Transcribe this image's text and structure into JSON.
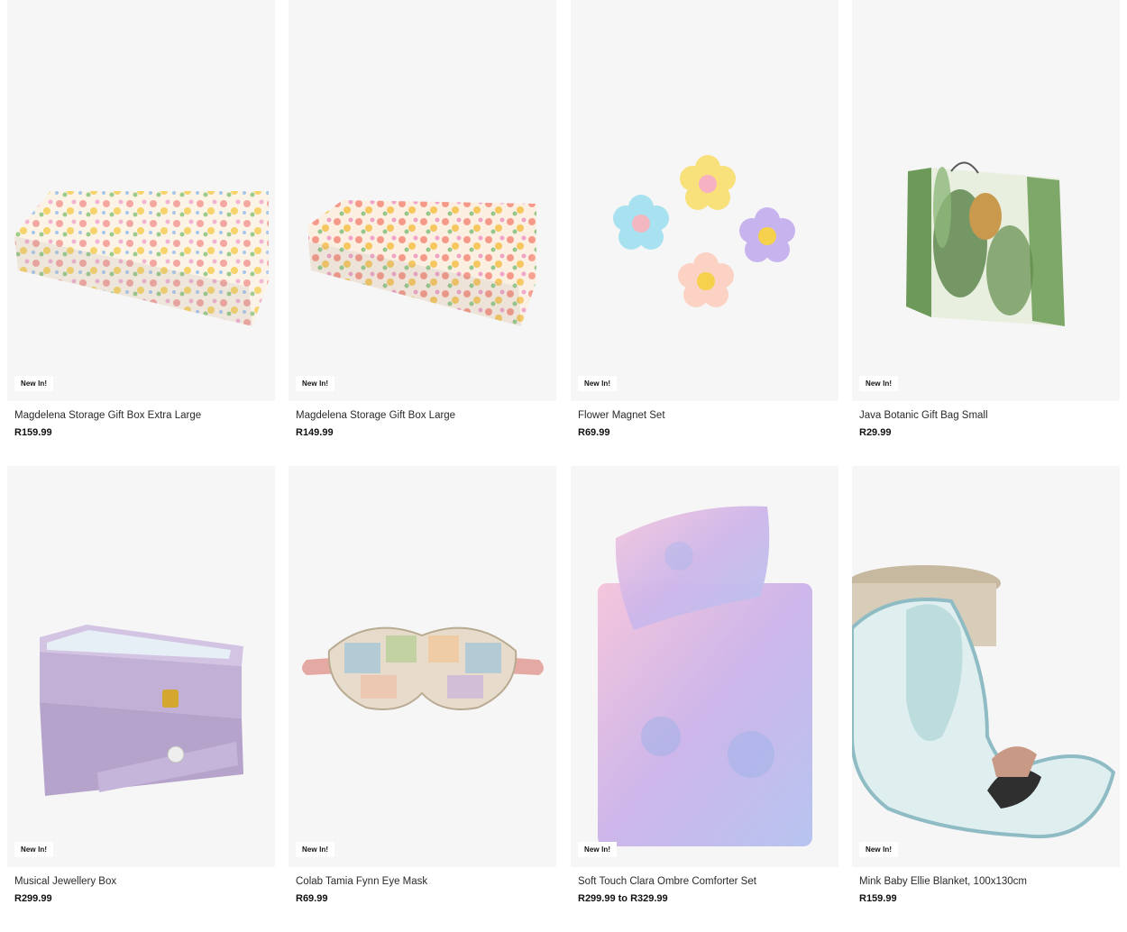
{
  "products": [
    {
      "name": "Magdelena Storage Gift Box Extra Large",
      "price": "R159.99",
      "badge": "New In!",
      "icon": "floral-gift-box-image"
    },
    {
      "name": "Magdelena Storage Gift Box Large",
      "price": "R149.99",
      "badge": "New In!",
      "icon": "floral-gift-box-image"
    },
    {
      "name": "Flower Magnet Set",
      "price": "R69.99",
      "badge": "New In!",
      "icon": "flower-magnets-image"
    },
    {
      "name": "Java Botanic Gift Bag Small",
      "price": "R29.99",
      "badge": "New In!",
      "icon": "gift-bag-image"
    },
    {
      "name": "Musical Jewellery Box",
      "price": "R299.99",
      "badge": "New In!",
      "icon": "jewellery-box-image"
    },
    {
      "name": "Colab Tamia Fynn Eye Mask",
      "price": "R69.99",
      "badge": "New In!",
      "icon": "eye-mask-image"
    },
    {
      "name": "Soft Touch Clara Ombre Comforter Set",
      "price": "R299.99 to R329.99",
      "badge": "New In!",
      "icon": "comforter-set-image"
    },
    {
      "name": "Mink Baby Ellie Blanket, 100x130cm",
      "price": "R159.99",
      "badge": "New In!",
      "icon": "baby-blanket-image"
    }
  ]
}
